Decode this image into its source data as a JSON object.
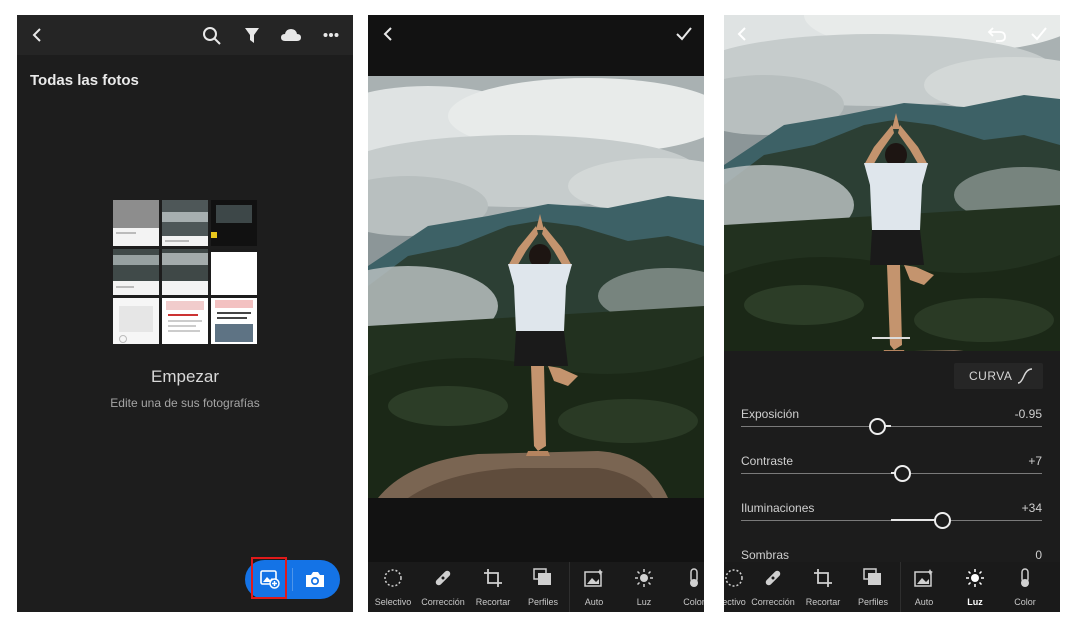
{
  "screen1": {
    "title": "Todas las fotos",
    "toolbar_icons": [
      "back-icon",
      "search-icon",
      "filter-icon",
      "cloud-icon",
      "more-icon"
    ],
    "empty_title": "Empezar",
    "empty_subtitle": "Edite una de sus fotografías",
    "fab_icons": [
      "add-photo-icon",
      "camera-icon"
    ]
  },
  "screen2": {
    "toolbar_icons": [
      "back-icon",
      "check-icon"
    ],
    "tools": [
      {
        "label": "Selectivo",
        "icon": "selective-icon"
      },
      {
        "label": "Corrección",
        "icon": "healing-icon"
      },
      {
        "label": "Recortar",
        "icon": "crop-icon"
      },
      {
        "label": "Perfiles",
        "icon": "profiles-icon"
      },
      {
        "label": "Auto",
        "icon": "auto-icon"
      },
      {
        "label": "Luz",
        "icon": "light-icon"
      },
      {
        "label": "Color",
        "icon": "color-icon"
      }
    ]
  },
  "screen3": {
    "toolbar_icons": [
      "back-icon",
      "undo-icon",
      "check-icon"
    ],
    "curve_label": "CURVA",
    "sliders": [
      {
        "name": "Exposición",
        "value": "-0.95",
        "level": -0.095
      },
      {
        "name": "Contraste",
        "value": "+7",
        "level": 0.07
      },
      {
        "name": "Iluminaciones",
        "value": "+34",
        "level": 0.34
      },
      {
        "name": "Sombras",
        "value": "0",
        "level": 0
      }
    ],
    "tools": [
      {
        "label": "ectivo",
        "icon": "selective-icon"
      },
      {
        "label": "Corrección",
        "icon": "healing-icon"
      },
      {
        "label": "Recortar",
        "icon": "crop-icon"
      },
      {
        "label": "Perfiles",
        "icon": "profiles-icon"
      },
      {
        "label": "Auto",
        "icon": "auto-icon"
      },
      {
        "label": "Luz",
        "icon": "light-icon"
      },
      {
        "label": "Color",
        "icon": "color-icon"
      }
    ],
    "active_tool": "Luz"
  },
  "colors": {
    "accent": "#1473e6",
    "highlight": "#e01a1a",
    "background": "#1d1d1d"
  }
}
